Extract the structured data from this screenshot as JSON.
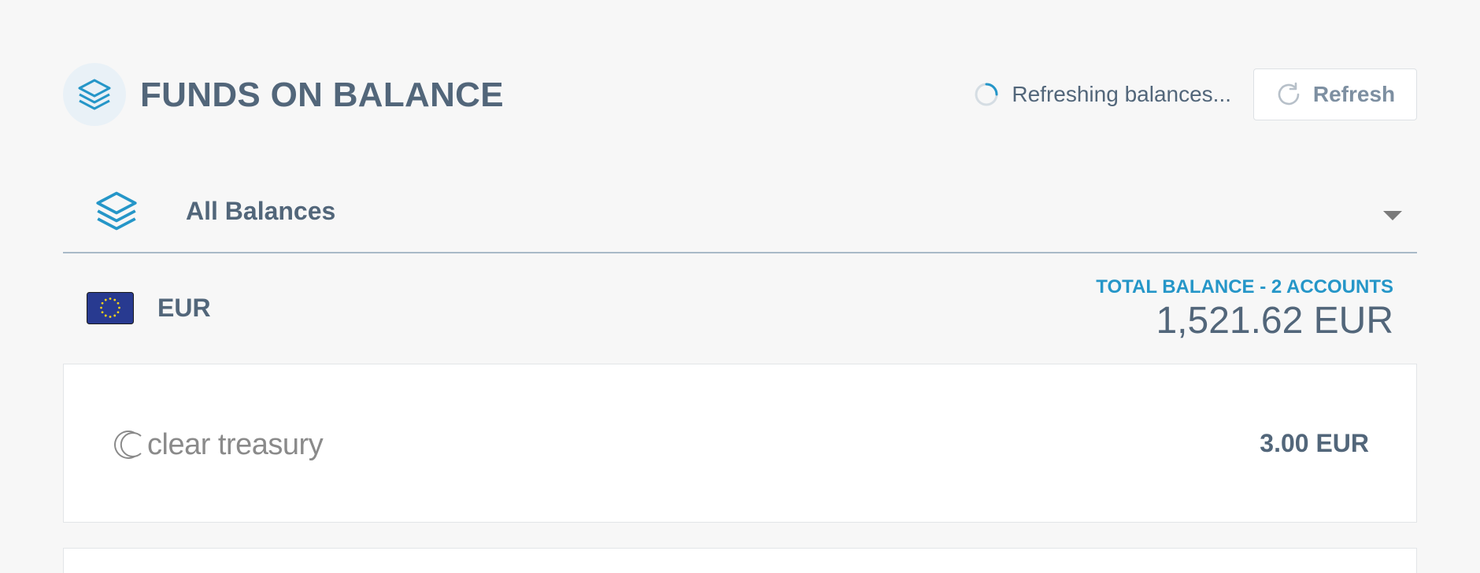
{
  "header": {
    "title": "FUNDS ON BALANCE",
    "icon": "layers-icon",
    "status_text": "Refreshing balances...",
    "refresh_label": "Refresh"
  },
  "selector": {
    "label": "All Balances",
    "icon": "layers-icon"
  },
  "currency_group": {
    "code": "EUR",
    "flag": "eu-flag-icon",
    "total_label": "TOTAL BALANCE - 2 ACCOUNTS",
    "total_amount": "1,521.62 EUR"
  },
  "accounts": [
    {
      "provider": "clear treasury",
      "amount": "3.00 EUR"
    }
  ],
  "colors": {
    "accent": "#2596c8",
    "text": "#52667a",
    "background": "#f7f7f7"
  }
}
